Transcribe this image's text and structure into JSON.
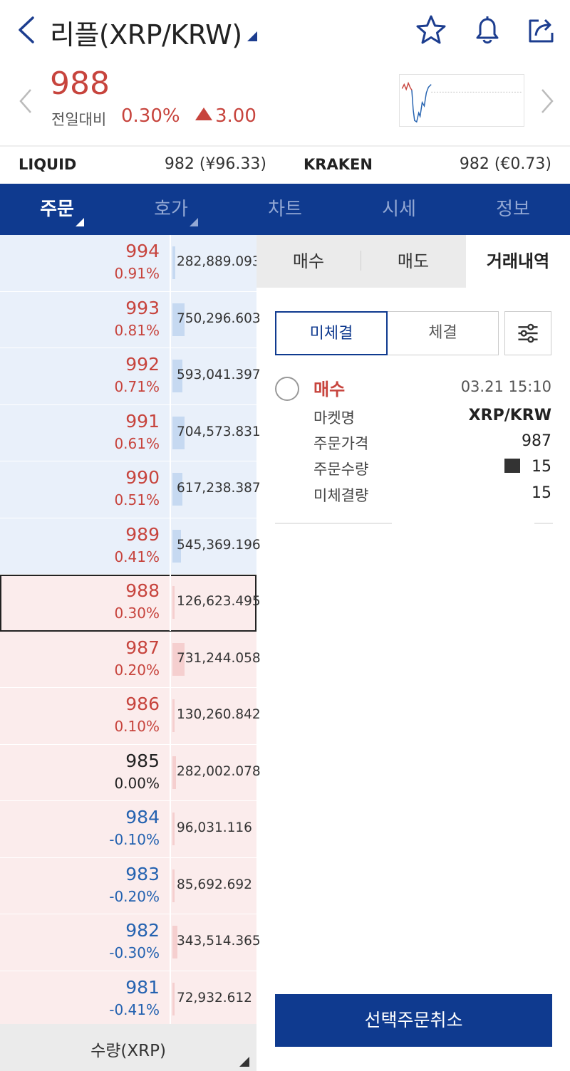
{
  "header": {
    "title": "리플(XRP/KRW)",
    "icons": [
      "back-icon",
      "star-icon",
      "bell-icon",
      "share-icon"
    ]
  },
  "ticker": {
    "price": "988",
    "prev_label": "전일대비",
    "change_pct": "0.30%",
    "change_abs": "3.00"
  },
  "exchanges": [
    {
      "name": "LIQUID",
      "value": "982 (¥96.33)"
    },
    {
      "name": "KRAKEN",
      "value": "982 (€0.73)"
    }
  ],
  "tabs": [
    {
      "label": "주문"
    },
    {
      "label": "호가"
    },
    {
      "label": "차트"
    },
    {
      "label": "시세"
    },
    {
      "label": "정보"
    }
  ],
  "orderbook": {
    "rows": [
      {
        "price": "994",
        "rate": "0.91%",
        "volume": "282,889.093",
        "side": "ask",
        "color": "red",
        "depth": 0.03
      },
      {
        "price": "993",
        "rate": "0.81%",
        "volume": "750,296.603",
        "side": "ask",
        "color": "red",
        "depth": 0.14
      },
      {
        "price": "992",
        "rate": "0.71%",
        "volume": "593,041.397",
        "side": "ask",
        "color": "red",
        "depth": 0.12
      },
      {
        "price": "991",
        "rate": "0.61%",
        "volume": "704,573.831",
        "side": "ask",
        "color": "red",
        "depth": 0.14
      },
      {
        "price": "990",
        "rate": "0.51%",
        "volume": "617,238.387",
        "side": "ask",
        "color": "red",
        "depth": 0.12
      },
      {
        "price": "989",
        "rate": "0.41%",
        "volume": "545,369.196",
        "side": "ask",
        "color": "red",
        "depth": 0.1
      },
      {
        "price": "988",
        "rate": "0.30%",
        "volume": "126,623.495",
        "side": "bid",
        "color": "red",
        "depth": 0.02,
        "current": true
      },
      {
        "price": "987",
        "rate": "0.20%",
        "volume": "731,244.058",
        "side": "bid",
        "color": "red",
        "depth": 0.14
      },
      {
        "price": "986",
        "rate": "0.10%",
        "volume": "130,260.842",
        "side": "bid",
        "color": "red",
        "depth": 0.02
      },
      {
        "price": "985",
        "rate": "0.00%",
        "volume": "282,002.078",
        "side": "bid",
        "color": "black",
        "depth": 0.04
      },
      {
        "price": "984",
        "rate": "-0.10%",
        "volume": "96,031.116",
        "side": "bid",
        "color": "blue",
        "depth": 0.02
      },
      {
        "price": "983",
        "rate": "-0.20%",
        "volume": "85,692.692",
        "side": "bid",
        "color": "blue",
        "depth": 0.02
      },
      {
        "price": "982",
        "rate": "-0.30%",
        "volume": "343,514.365",
        "side": "bid",
        "color": "blue",
        "depth": 0.06
      },
      {
        "price": "981",
        "rate": "-0.41%",
        "volume": "72,932.612",
        "side": "bid",
        "color": "blue",
        "depth": 0.02
      }
    ],
    "qty_selector": "수량(XRP)"
  },
  "trade_panel": {
    "tabs": [
      {
        "label": "매수"
      },
      {
        "label": "매도"
      },
      {
        "label": "거래내역"
      }
    ],
    "segment": {
      "unfilled": "미체결",
      "filled": "체결"
    },
    "order": {
      "type": "매수",
      "time": "03.21 15:10",
      "fields": [
        {
          "label": "마켓명",
          "value": "XRP/KRW"
        },
        {
          "label": "주문가격",
          "value": "987"
        },
        {
          "label": "주문수량",
          "value": "15"
        },
        {
          "label": "미체결량",
          "value": "15"
        }
      ]
    },
    "cancel_button": "선택주문취소"
  },
  "colors": {
    "up": "#c7443d",
    "down": "#2462b0",
    "brand": "#0f3a8f",
    "ask_bg": "#e9f0fa",
    "bid_bg": "#fbecec"
  }
}
